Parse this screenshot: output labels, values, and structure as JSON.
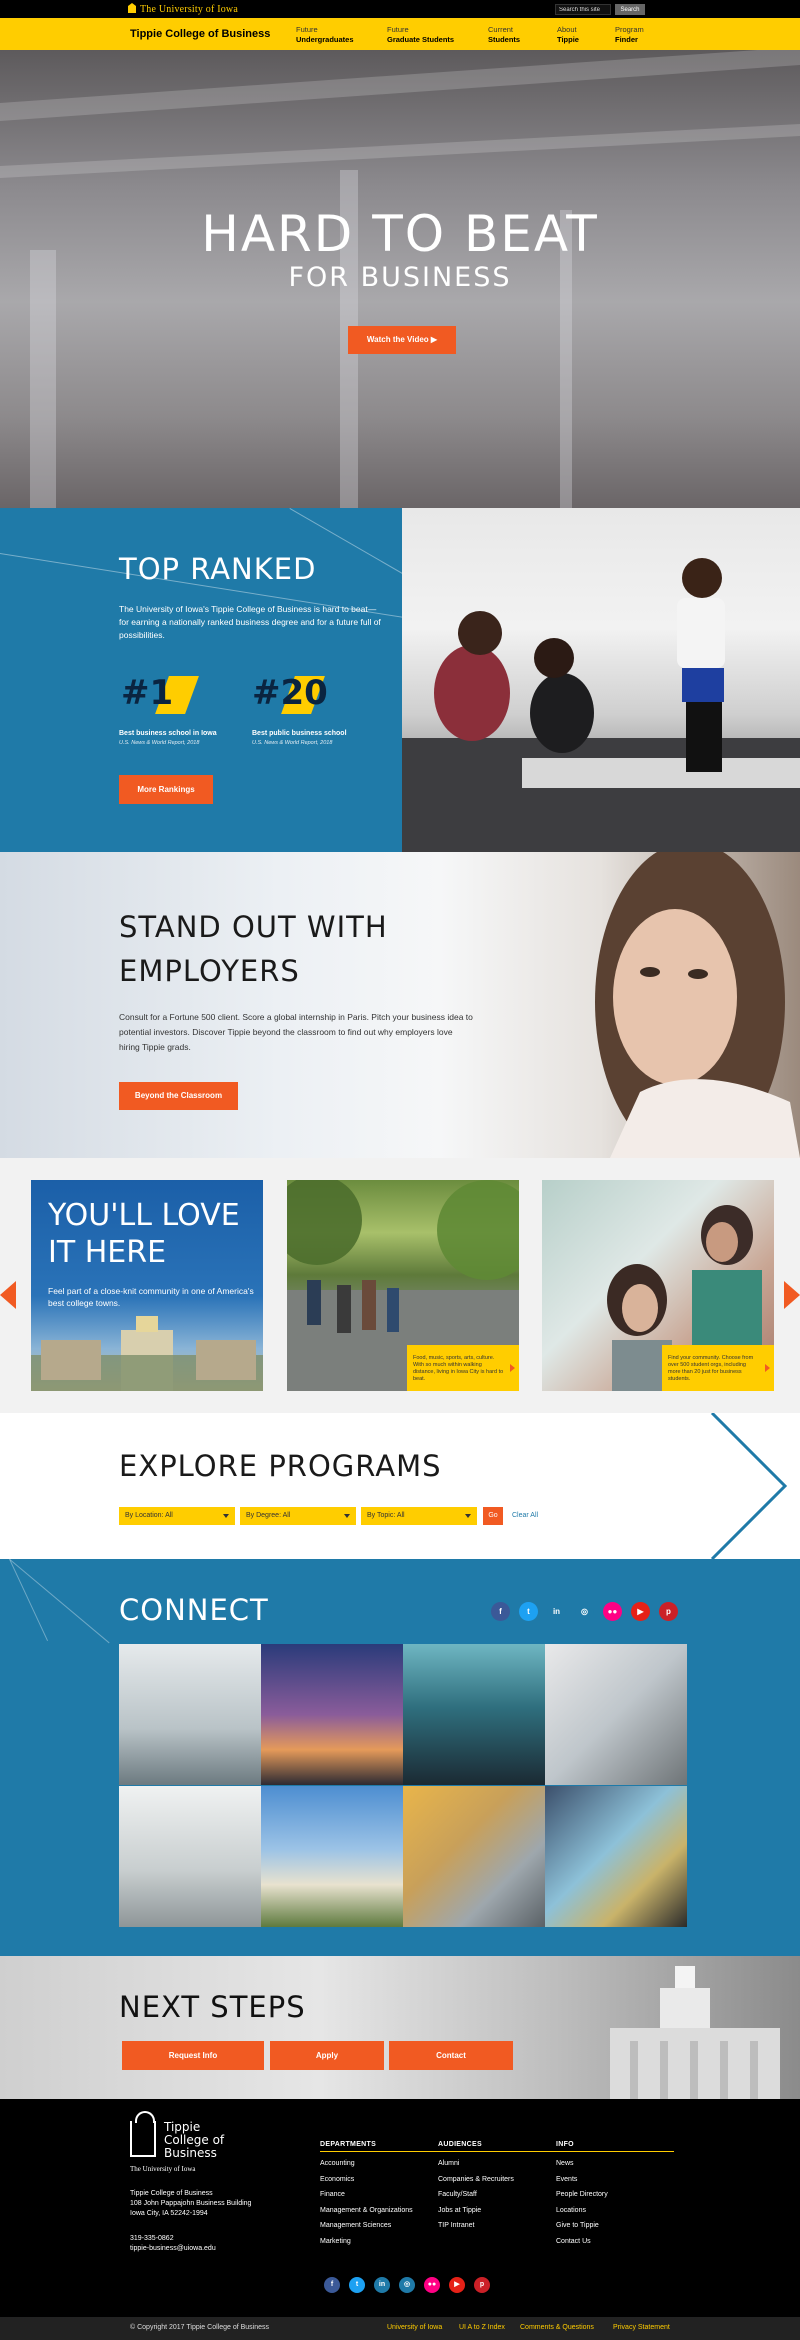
{
  "topbar": {
    "uiowa_logo": "The University of Iowa",
    "search_placeholder": "Search this site",
    "search_button": "Search"
  },
  "nav": {
    "site_title": "Tippie College of Business",
    "items": [
      {
        "line1": "Future",
        "line2": "Undergraduates"
      },
      {
        "line1": "Future",
        "line2": "Graduate Students"
      },
      {
        "line1": "Current",
        "line2": "Students"
      },
      {
        "line1": "About",
        "line2": "Tippie"
      },
      {
        "line1": "Program",
        "line2": "Finder"
      }
    ]
  },
  "hero": {
    "title": "HARD TO BEAT",
    "subtitle": "FOR BUSINESS",
    "button": "Watch the Video ▶"
  },
  "ranked": {
    "title": "TOP RANKED",
    "text": "The University of Iowa's Tippie College of Business is hard to beat— for earning a nationally ranked business degree and for a future full of possibilities.",
    "ranks": [
      {
        "number": "#1",
        "label": "Best business school in Iowa",
        "source": "U.S. News & World Report, 2018"
      },
      {
        "number": "#20",
        "label": "Best public business school",
        "source": "U.S. News & World Report, 2018"
      }
    ],
    "button": "More Rankings"
  },
  "employers": {
    "title": "STAND OUT WITH EMPLOYERS",
    "text": "Consult for a Fortune 500 client. Score a global internship in Paris. Pitch your business idea to potential investors. Discover Tippie beyond the classroom to find out why employers love hiring Tippie grads.",
    "button": "Beyond the Classroom"
  },
  "carousel": {
    "card1_title": "YOU'LL LOVE IT HERE",
    "card1_text": "Feel part of a close-knit community in one of America's best college towns.",
    "card2_caption": "Food, music, sports, arts, culture. With so much within walking distance, living in Iowa City is hard to beat.",
    "card3_caption": "Find your community. Choose from over 500 student orgs, including more than 20 just for business students."
  },
  "explore": {
    "title": "EXPLORE PROGRAMS",
    "filters": [
      "By Location: All",
      "By Degree: All",
      "By Topic: All"
    ],
    "go": "Go",
    "clear": "Clear All"
  },
  "connect": {
    "title": "CONNECT",
    "social": [
      {
        "name": "facebook-icon",
        "glyph": "f",
        "color": "#3b5998"
      },
      {
        "name": "twitter-icon",
        "glyph": "t",
        "color": "#1da1f2"
      },
      {
        "name": "linkedin-icon",
        "glyph": "in",
        "color": "#1f7aa8"
      },
      {
        "name": "instagram-icon",
        "glyph": "◎",
        "color": "#1f7aa8"
      },
      {
        "name": "flickr-icon",
        "glyph": "●●",
        "color": "#ff0084"
      },
      {
        "name": "youtube-icon",
        "glyph": "▶",
        "color": "#e62117"
      },
      {
        "name": "pinterest-icon",
        "glyph": "p",
        "color": "#cb2027"
      }
    ]
  },
  "next_steps": {
    "title": "NEXT STEPS",
    "buttons": [
      "Request Info",
      "Apply",
      "Contact"
    ]
  },
  "footer": {
    "logo_name": "Tippie College of Business",
    "logo_uiowa": "The University of Iowa",
    "address_lines": [
      "Tippie College of Business",
      "108 John Pappajohn Business Building",
      "Iowa City, IA 52242-1994"
    ],
    "phone": "319-335-0862",
    "email": "tippie-business@uiowa.edu",
    "columns": [
      {
        "heading": "DEPARTMENTS",
        "links": [
          "Accounting",
          "Economics",
          "Finance",
          "Management & Organizations",
          "Management Sciences",
          "Marketing"
        ]
      },
      {
        "heading": "AUDIENCES",
        "links": [
          "Alumni",
          "Companies & Recruiters",
          "Faculty/Staff",
          "Jobs at Tippie",
          "TIP Intranet"
        ]
      },
      {
        "heading": "INFO",
        "links": [
          "News",
          "Events",
          "People Directory",
          "Locations",
          "Give to Tippie",
          "Contact Us"
        ]
      }
    ],
    "copyright": "© Copyright 2017 Tippie College of Business",
    "bottom_links": [
      "University of Iowa",
      "UI A to Z Index",
      "Comments & Questions",
      "Privacy Statement"
    ]
  },
  "colors": {
    "gold": "#ffcd00",
    "orange": "#f15a22",
    "blue": "#1f7aa8"
  }
}
